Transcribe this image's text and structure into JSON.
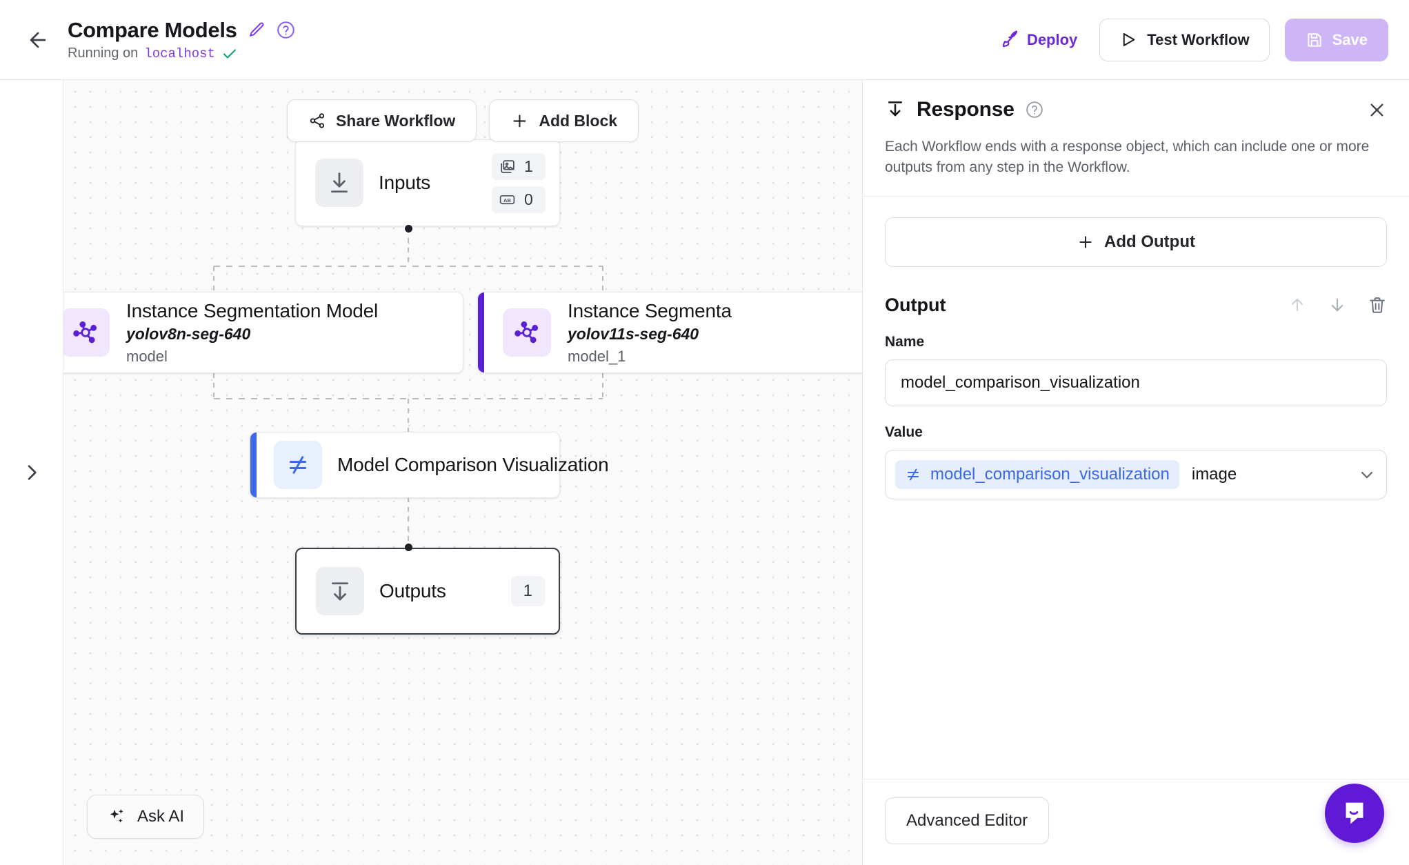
{
  "header": {
    "back_icon": "arrow-left-icon",
    "title": "Compare Models",
    "edit_icon": "pencil-icon",
    "help_icon": "question-circle-icon",
    "status_prefix": "Running on",
    "status_host": "localhost",
    "status_check_icon": "check-icon",
    "deploy_label": "Deploy",
    "deploy_icon": "rocket-icon",
    "test_label": "Test Workflow",
    "test_icon": "play-icon",
    "save_label": "Save",
    "save_icon": "floppy-disk-icon",
    "deploy_color": "#6d28d9",
    "save_bg": "#cdb4f6"
  },
  "left_rail": {
    "expand_icon": "chevron-right-icon"
  },
  "canvas": {
    "share_label": "Share Workflow",
    "share_icon": "share-nodes-icon",
    "add_block_label": "Add Block",
    "add_block_icon": "plus-icon",
    "ask_ai_label": "Ask AI",
    "ask_ai_icon": "sparkles-icon",
    "nodes": {
      "inputs": {
        "title": "Inputs",
        "icon": "arrow-down-to-line-icon",
        "badge_image_icon": "images-icon",
        "badge_image_count": "1",
        "badge_text_icon": "ab-text-icon",
        "badge_text_count": "0"
      },
      "model_a": {
        "title": "Instance Segmentation Model",
        "subtitle": "yolov8n-seg-640",
        "id": "model",
        "icon": "model-graph-icon",
        "accent": "#5b1fd6"
      },
      "model_b": {
        "title": "Instance Segmenta",
        "subtitle": "yolov11s-seg-640",
        "id": "model_1",
        "icon": "model-graph-icon",
        "accent": "#5b1fd6"
      },
      "visualization": {
        "title": "Model Comparison Visualization",
        "icon": "not-equal-icon",
        "accent": "#3b69e8"
      },
      "outputs": {
        "title": "Outputs",
        "icon": "arrow-down-from-line-icon",
        "badge_count": "1"
      }
    }
  },
  "panel": {
    "title": "Response",
    "title_icon": "arrow-down-to-line-icon",
    "help_icon": "question-circle-icon",
    "close_icon": "close-icon",
    "description": "Each Workflow ends with a response object, which can include one or more outputs from any step in the Workflow.",
    "add_output_label": "Add Output",
    "add_output_icon": "plus-icon",
    "output_heading": "Output",
    "move_up_icon": "arrow-up-icon",
    "move_down_icon": "arrow-down-icon",
    "delete_icon": "trash-icon",
    "name_label": "Name",
    "name_value": "model_comparison_visualization",
    "value_label": "Value",
    "value_chip_icon": "not-equal-icon",
    "value_chip_text": "model_comparison_visualization",
    "value_type": "image",
    "value_caret_icon": "chevron-down-icon",
    "advanced_editor_label": "Advanced Editor"
  },
  "widget": {
    "intercom_icon": "chat-bubble-icon",
    "color": "#6019d4"
  }
}
